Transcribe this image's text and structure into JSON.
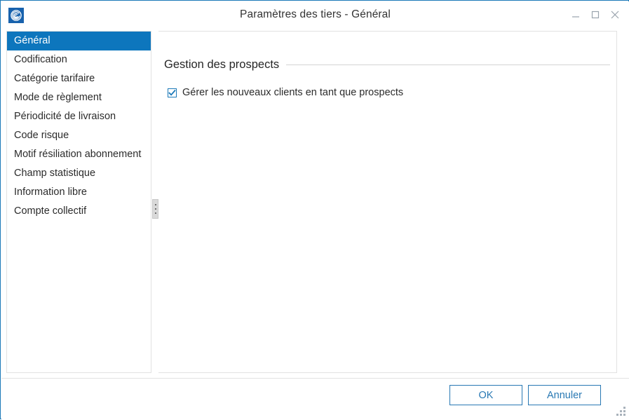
{
  "window": {
    "title": "Paramètres des tiers - Général",
    "icon": "app-spiral-icon",
    "accent_color": "#1b79b8",
    "controls": {
      "minimize": "minimize-icon",
      "maximize": "maximize-icon",
      "close": "close-icon"
    }
  },
  "sidebar": {
    "items": [
      {
        "label": "Général",
        "selected": true
      },
      {
        "label": "Codification",
        "selected": false
      },
      {
        "label": "Catégorie tarifaire",
        "selected": false
      },
      {
        "label": "Mode de règlement",
        "selected": false
      },
      {
        "label": "Périodicité de livraison",
        "selected": false
      },
      {
        "label": "Code risque",
        "selected": false
      },
      {
        "label": "Motif résiliation abonnement",
        "selected": false
      },
      {
        "label": "Champ statistique",
        "selected": false
      },
      {
        "label": "Information libre",
        "selected": false
      },
      {
        "label": "Compte collectif",
        "selected": false
      }
    ],
    "selected_color": "#0d76bd"
  },
  "splitter": {
    "grip": "splitter-grip-dots"
  },
  "main": {
    "group_title": "Gestion des prospects",
    "checkbox": {
      "label": "Gérer les nouveaux clients en tant que prospects",
      "checked": true,
      "check_color": "#1b79b8"
    }
  },
  "footer": {
    "ok_label": "OK",
    "cancel_label": "Annuler",
    "button_color": "#2878b3"
  }
}
